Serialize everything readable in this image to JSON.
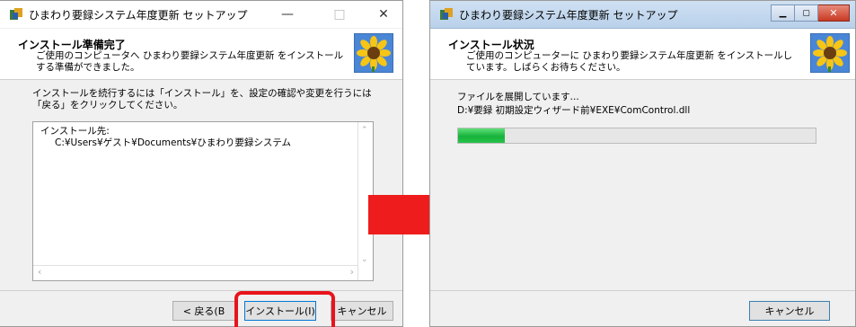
{
  "window1": {
    "title": "ひまわり要録システム年度更新 セットアップ",
    "controls": {
      "minimize": "—",
      "maximize": "□",
      "close": "✕"
    },
    "header_title": "インストール準備完了",
    "header_desc": "ご使用のコンピュータへ ひまわり要録システム年度更新 をインストールする準備ができました。",
    "instruction": "インストールを続行するには「インストール」を、設定の確認や変更を行うには「戻る」をクリックしてください。",
    "install_dest_label": "インストール先:",
    "install_dest_path": "C:¥Users¥ゲスト¥Documents¥ひまわり要録システム",
    "back_button": "< 戻る(B",
    "install_button": "インストール(I)",
    "cancel_button": "キャンセル"
  },
  "window2": {
    "title": "ひまわり要録システム年度更新 セットアップ",
    "header_title": "インストール状況",
    "header_desc": "ご使用のコンピューターに ひまわり要録システム年度更新 をインストールしています。しばらくお待ちください。",
    "status_text": "ファイルを展開しています...",
    "file_path": "D:¥要録 初期設定ウィザード前¥EXE¥ComControl.dll",
    "progress": 0.13,
    "cancel_button": "キャンセル"
  },
  "colors": {
    "highlight": "#e8141b",
    "arrow": "#ee1c1c",
    "progress": "#2dbf4a"
  },
  "icons": {
    "app": "setup-app-icon",
    "header_image": "sunflower-image",
    "arrow": "right-arrow"
  }
}
